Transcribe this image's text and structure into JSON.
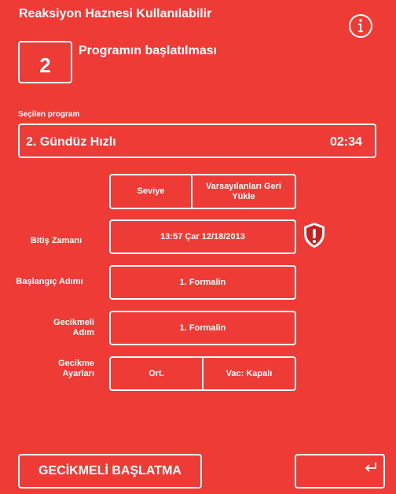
{
  "header": {
    "title": "Reaksiyon Haznesi Kullanılabilir",
    "info_icon": "info-icon"
  },
  "step": {
    "number": "2",
    "title": "Programın başlatılması"
  },
  "selected_program": {
    "label": "Seçilen program",
    "name": "2. Gündüz Hızlı",
    "duration": "02:34"
  },
  "top_buttons": {
    "level": "Seviye",
    "restore_defaults": "Varsayılanları Geri Yükle"
  },
  "rows": {
    "end_time_label": "Bitiş Zamanı",
    "end_time_value": "13:57  Çar 12/18/2013",
    "start_step_label": "Başlangıç Adımı",
    "start_step_value": "1. Formalin",
    "delayed_step_label": "Gecikmeli Adım",
    "delayed_step_value": "1. Formalin",
    "delay_settings_label": "Gecikme Ayarları",
    "delay_settings_temp": "Ort.",
    "delay_settings_vac": "Vac: Kapalı"
  },
  "footer": {
    "delayed_start": "GECİKMELİ BAŞLATMA",
    "back_icon": "return-icon"
  },
  "colors": {
    "background": "#ef3b36",
    "foreground": "#ffffff"
  }
}
